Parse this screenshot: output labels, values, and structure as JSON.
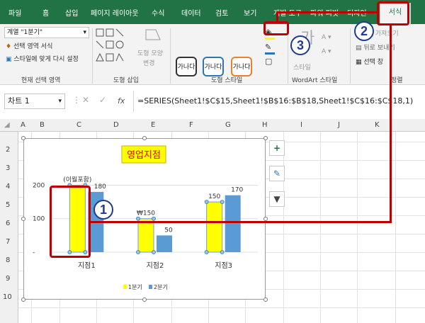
{
  "tabs": [
    "파일",
    "홈",
    "삽입",
    "페이지 레이아웃",
    "수식",
    "데이터",
    "검토",
    "보기",
    "개발 도구",
    "파워 피벗",
    "디자인",
    "서식"
  ],
  "ribbon": {
    "selection_dropdown": "계열 \"1분기\"",
    "format_selection": "선택 영역 서식",
    "reset_style": "스타일에 맞게 다시 설정",
    "group_current_selection": "현재 선택 영역",
    "group_insert_shapes": "도형 삽입",
    "change_shape": "도형 모양",
    "change_shape2": "변경",
    "style_sample": "가나다",
    "group_shape_styles": "도형 스타일",
    "wordart_styles": "WordArt 스타일",
    "quick_styles": "스타일",
    "send_backward": "뒤로 보내기",
    "bring_forward": "앞으로 가져오기",
    "selection_pane": "선택 창",
    "group_arrange": "정렬"
  },
  "formula_bar": {
    "name_box": "차트 1",
    "fx": "fx",
    "formula": "=SERIES(Sheet1!$C$15,Sheet1!$B$16:$B$18,Sheet1!$C$16:$C$18,1)"
  },
  "columns": [
    "A",
    "B",
    "C",
    "D",
    "E",
    "F",
    "G",
    "H",
    "I",
    "J",
    "K"
  ],
  "rows": [
    "2",
    "3",
    "4",
    "5",
    "6",
    "7",
    "8",
    "9",
    "10"
  ],
  "chart_data": {
    "type": "bar",
    "title": "영업지점",
    "categories": [
      "지점1",
      "지점2",
      "지점3"
    ],
    "series": [
      {
        "name": "1분기",
        "values": [
          200,
          100,
          150
        ],
        "color": "#ffff00"
      },
      {
        "name": "2분기",
        "values": [
          180,
          50,
          170
        ],
        "color": "#5b9bd5"
      }
    ],
    "data_labels": {
      "s0": [
        "(이월포함)",
        "₩150",
        "150"
      ],
      "s1": [
        "180",
        "50",
        "170"
      ]
    },
    "y_ticks": [
      "200",
      "100",
      "-"
    ],
    "ylim": [
      0,
      220
    ]
  },
  "badges": [
    "1",
    "2",
    "3"
  ],
  "colors": {
    "accent": "#217346",
    "callout": "#c00000",
    "badge": "#1f3b8f"
  }
}
